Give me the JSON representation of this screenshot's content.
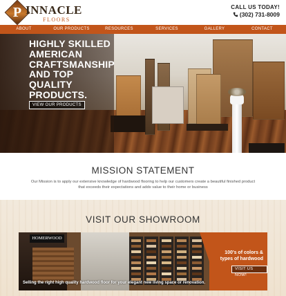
{
  "header": {
    "logo_letter": "P",
    "logo_word": "INNACLE",
    "logo_sub": "FLOORS",
    "call_title": "CALL US TODAY!",
    "phone": "(302) 731-8009"
  },
  "nav": {
    "items": [
      "ABOUT",
      "OUR PRODUCTS",
      "RESOURCES",
      "SERVICES",
      "GALLERY",
      "CONTACT"
    ]
  },
  "hero": {
    "headline": "HIGHLY SKILLED AMERICAN CRAFTSMANSHIP AND TOP QUALITY PRODUCTS.",
    "cta": "VIEW OUR PRODUCTS"
  },
  "mission": {
    "title": "MISSION STATEMENT",
    "text": "Our Mission is to apply our extensive knowledge of hardwood flooring to help our customers create a beautiful finished product that exceeds their expectations and adds value to their home or business"
  },
  "showroom": {
    "title": "VISIT OUR SHOWROOM",
    "sign": "HOMERWOOD",
    "panel_text": "100's of colors & types of hardwood",
    "panel_cta": "VISIT US NOW!",
    "caption": "Selling the right high quality hardwood floor for your elegant new living space or renovation."
  },
  "colors": {
    "accent": "#c2551a"
  },
  "icons": {
    "phone": "phone-icon",
    "slider": "slider-dot-icon"
  }
}
